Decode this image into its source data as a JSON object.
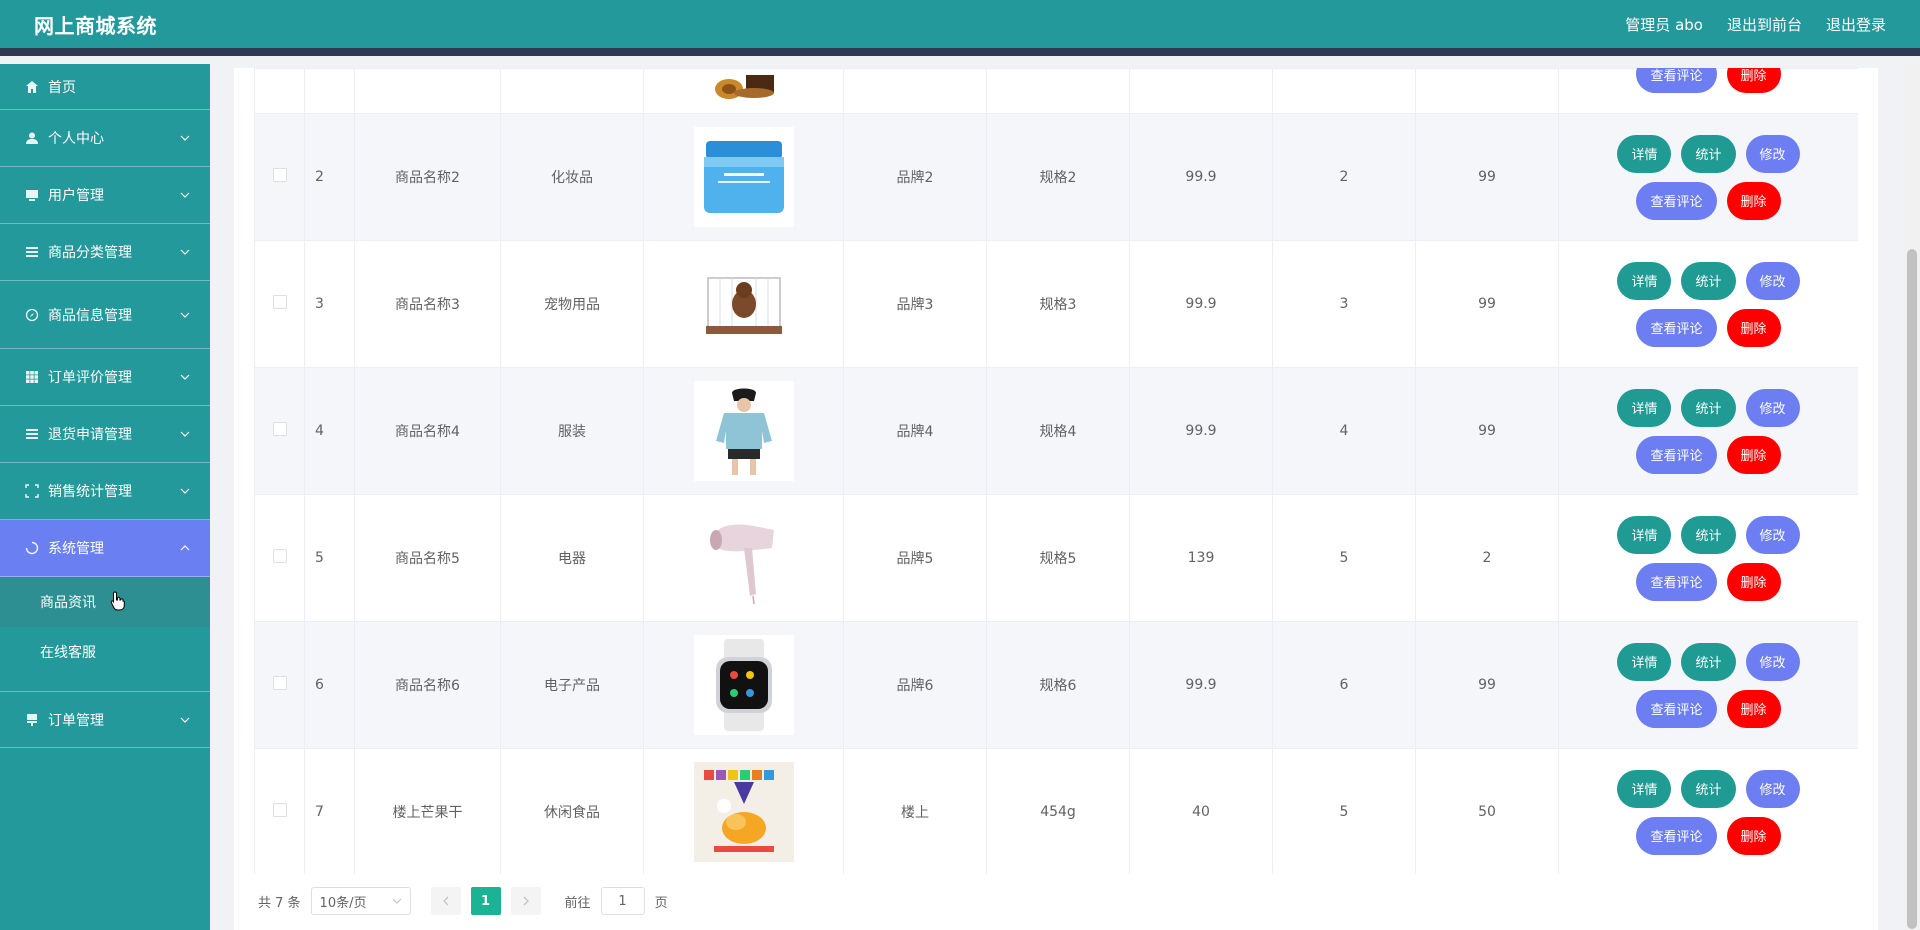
{
  "header": {
    "title": "网上商城系统",
    "admin_label": "管理员 abo",
    "to_front": "退出到前台",
    "logout": "退出登录"
  },
  "sidebar": {
    "items": [
      {
        "label": "首页",
        "icon": "home-icon"
      },
      {
        "label": "个人中心",
        "icon": "user-icon"
      },
      {
        "label": "用户管理",
        "icon": "monitor-icon"
      },
      {
        "label": "商品分类管理",
        "icon": "list-icon"
      },
      {
        "label": "商品信息管理",
        "icon": "compass-icon"
      },
      {
        "label": "订单评价管理",
        "icon": "grid-icon"
      },
      {
        "label": "退货申请管理",
        "icon": "list-icon"
      },
      {
        "label": "销售统计管理",
        "icon": "frame-icon"
      },
      {
        "label": "系统管理",
        "icon": "loading-icon"
      },
      {
        "label": "订单管理",
        "icon": "flag-icon"
      }
    ],
    "sub_items": [
      "商品资讯",
      "在线客服"
    ]
  },
  "table": {
    "rows": [
      {
        "idx": "2",
        "name": "商品名称2",
        "category": "化妆品",
        "image": "cream-jar",
        "brand": "品牌2",
        "spec": "规格2",
        "price": "99.9",
        "qty": "2",
        "stock": "99"
      },
      {
        "idx": "3",
        "name": "商品名称3",
        "category": "宠物用品",
        "image": "pet-cage",
        "brand": "品牌3",
        "spec": "规格3",
        "price": "99.9",
        "qty": "3",
        "stock": "99"
      },
      {
        "idx": "4",
        "name": "商品名称4",
        "category": "服装",
        "image": "hoodie",
        "brand": "品牌4",
        "spec": "规格4",
        "price": "99.9",
        "qty": "4",
        "stock": "99"
      },
      {
        "idx": "5",
        "name": "商品名称5",
        "category": "电器",
        "image": "hair-dryer",
        "brand": "品牌5",
        "spec": "规格5",
        "price": "139",
        "qty": "5",
        "stock": "2"
      },
      {
        "idx": "6",
        "name": "商品名称6",
        "category": "电子产品",
        "image": "smart-watch",
        "brand": "品牌6",
        "spec": "规格6",
        "price": "99.9",
        "qty": "6",
        "stock": "99"
      },
      {
        "idx": "7",
        "name": "楼上芒果干",
        "category": "休闲食品",
        "image": "snack-bag",
        "brand": "楼上",
        "spec": "454g",
        "price": "40",
        "qty": "5",
        "stock": "50"
      }
    ],
    "buttons": {
      "detail": "详情",
      "stats": "统计",
      "edit": "修改",
      "comments": "查看评论",
      "delete": "删除"
    }
  },
  "pagination": {
    "total": "共 7 条",
    "page_size": "10条/页",
    "current": "1",
    "goto_label": "前往",
    "goto_value": "1",
    "page_suffix": "页"
  },
  "colors": {
    "primary": "#24999b",
    "active": "#6a80f2",
    "teal_btn": "#1f9b94",
    "blue_btn": "#6d7ef3",
    "red_btn": "#ff0000",
    "page_active": "#1ab394"
  }
}
